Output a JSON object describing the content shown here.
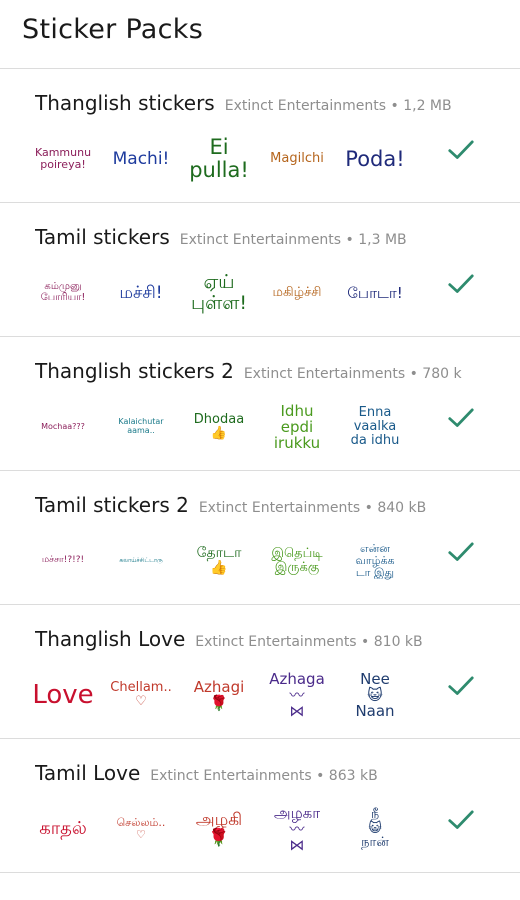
{
  "header": {
    "title": "Sticker Packs"
  },
  "colors": {
    "check": "#2e8b6e",
    "divider": "#dcdcdc",
    "meta": "#8e8e8e"
  },
  "packs": [
    {
      "name": "Thanglish stickers",
      "meta": "Extinct Entertainments • 1,2 MB",
      "stickers": [
        {
          "text": "Kammunu\npoireya!",
          "color": "#8b1e5a",
          "size": 11
        },
        {
          "text": "Machi!",
          "color": "#1f3c9e",
          "size": 17
        },
        {
          "text": "Ei\npulla!",
          "color": "#1e6b1e",
          "size": 21
        },
        {
          "text": "Magilchi",
          "color": "#b5651d",
          "size": 13
        },
        {
          "text": "Poda!",
          "color": "#1f2a7a",
          "size": 21
        }
      ]
    },
    {
      "name": "Tamil stickers",
      "meta": "Extinct Entertainments • 1,3 MB",
      "stickers": [
        {
          "text": "கம்முனு\nபோரியா!",
          "color": "#8b1e5a",
          "size": 10
        },
        {
          "text": "மச்சி!",
          "color": "#1f3c9e",
          "size": 17
        },
        {
          "text": "ஏய்\nபுள்ள!",
          "color": "#1e6b1e",
          "size": 19
        },
        {
          "text": "மகிழ்ச்சி",
          "color": "#b5651d",
          "size": 13
        },
        {
          "text": "போடா!",
          "color": "#1f2a7a",
          "size": 15
        }
      ]
    },
    {
      "name": "Thanglish stickers 2",
      "meta": "Extinct Entertainments • 780 k",
      "stickers": [
        {
          "text": "Mochaa???",
          "color": "#8b1e5a",
          "size": 8
        },
        {
          "text": "Kalaichutar\naama..",
          "color": "#1a7a8a",
          "size": 8
        },
        {
          "text": "Dhodaa\n👍",
          "color": "#1e6b1e",
          "size": 13
        },
        {
          "text": "Idhu\nepdi\nirukku",
          "color": "#4a9a1e",
          "size": 15
        },
        {
          "text": "Enna\nvaalka\nda idhu",
          "color": "#1a5a8a",
          "size": 13
        }
      ]
    },
    {
      "name": "Tamil stickers 2",
      "meta": "Extinct Entertainments • 840 kB",
      "stickers": [
        {
          "text": "மச்சா!?!?!",
          "color": "#8b1e5a",
          "size": 9
        },
        {
          "text": "கலாய்ச்சிட்டாரு",
          "color": "#1a7a8a",
          "size": 6
        },
        {
          "text": "தோடா\n👍",
          "color": "#1e6b1e",
          "size": 14
        },
        {
          "text": "இதெப்டி\nஇருக்கு",
          "color": "#4a9a1e",
          "size": 13
        },
        {
          "text": "என்ன\nவாழ்க்க\nடா இது",
          "color": "#1a5a8a",
          "size": 11
        }
      ]
    },
    {
      "name": "Thanglish Love",
      "meta": "Extinct Entertainments • 810 kB",
      "stickers": [
        {
          "text": "Love",
          "color": "#c8102e",
          "size": 26
        },
        {
          "text": "Chellam..\n♡",
          "color": "#c0392b",
          "size": 13
        },
        {
          "text": "Azhagi\n🌹",
          "color": "#c0392b",
          "size": 15
        },
        {
          "text": "Azhaga\n〰\n⋈",
          "color": "#4a2a8a",
          "size": 15
        },
        {
          "text": "Nee\n😺\nNaan",
          "color": "#1f3c6e",
          "size": 15
        }
      ]
    },
    {
      "name": "Tamil Love",
      "meta": "Extinct Entertainments • 863 kB",
      "stickers": [
        {
          "text": "காதல்",
          "color": "#c8102e",
          "size": 18
        },
        {
          "text": "செல்லம்..\n♡",
          "color": "#c0392b",
          "size": 11
        },
        {
          "text": "அழகி\n🌹",
          "color": "#c0392b",
          "size": 17
        },
        {
          "text": "அழகா\n〰\n⋈",
          "color": "#4a2a8a",
          "size": 15
        },
        {
          "text": "நீ\n😺\nநான்",
          "color": "#1f3c6e",
          "size": 13
        }
      ]
    }
  ]
}
